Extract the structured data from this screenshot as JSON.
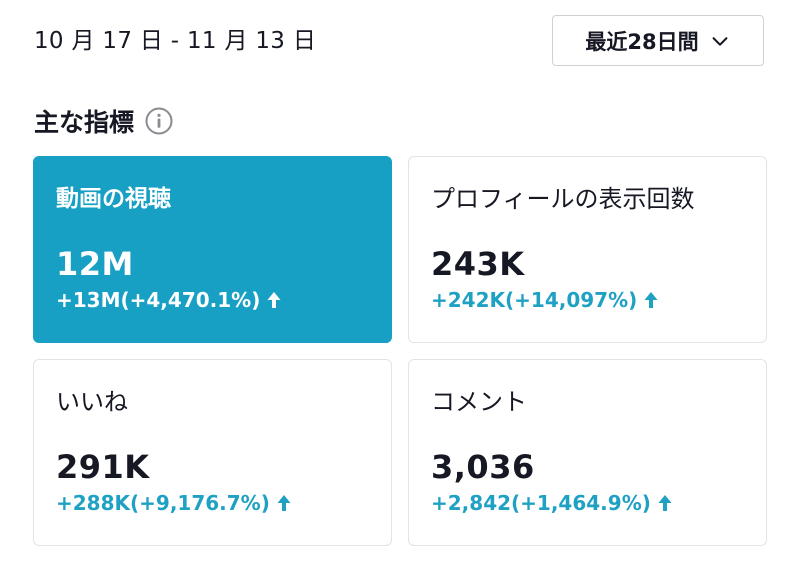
{
  "date_range": "10 月 17 日 - 11 月 13 日",
  "period_select": {
    "selected": "最近28日間",
    "icon": "chevron-down-icon"
  },
  "section": {
    "title": "主な指標",
    "info_icon": "info-icon"
  },
  "metrics": [
    {
      "key": "video-views",
      "label": "動画の視聴",
      "value": "12M",
      "change": "+13M(+4,470.1%)",
      "trend": "up",
      "active": true
    },
    {
      "key": "profile-views",
      "label": "プロフィールの表示回数",
      "value": "243K",
      "change": "+242K(+14,097%)",
      "trend": "up",
      "active": false
    },
    {
      "key": "likes",
      "label": "いいね",
      "value": "291K",
      "change": "+288K(+9,176.7%)",
      "trend": "up",
      "active": false
    },
    {
      "key": "comments",
      "label": "コメント",
      "value": "3,036",
      "change": "+2,842(+1,464.9%)",
      "trend": "up",
      "active": false
    }
  ],
  "colors": {
    "accent": "#18a0c4",
    "positive_change": "#1fa1c4",
    "text": "#161823",
    "border": "#e3e3e4"
  }
}
